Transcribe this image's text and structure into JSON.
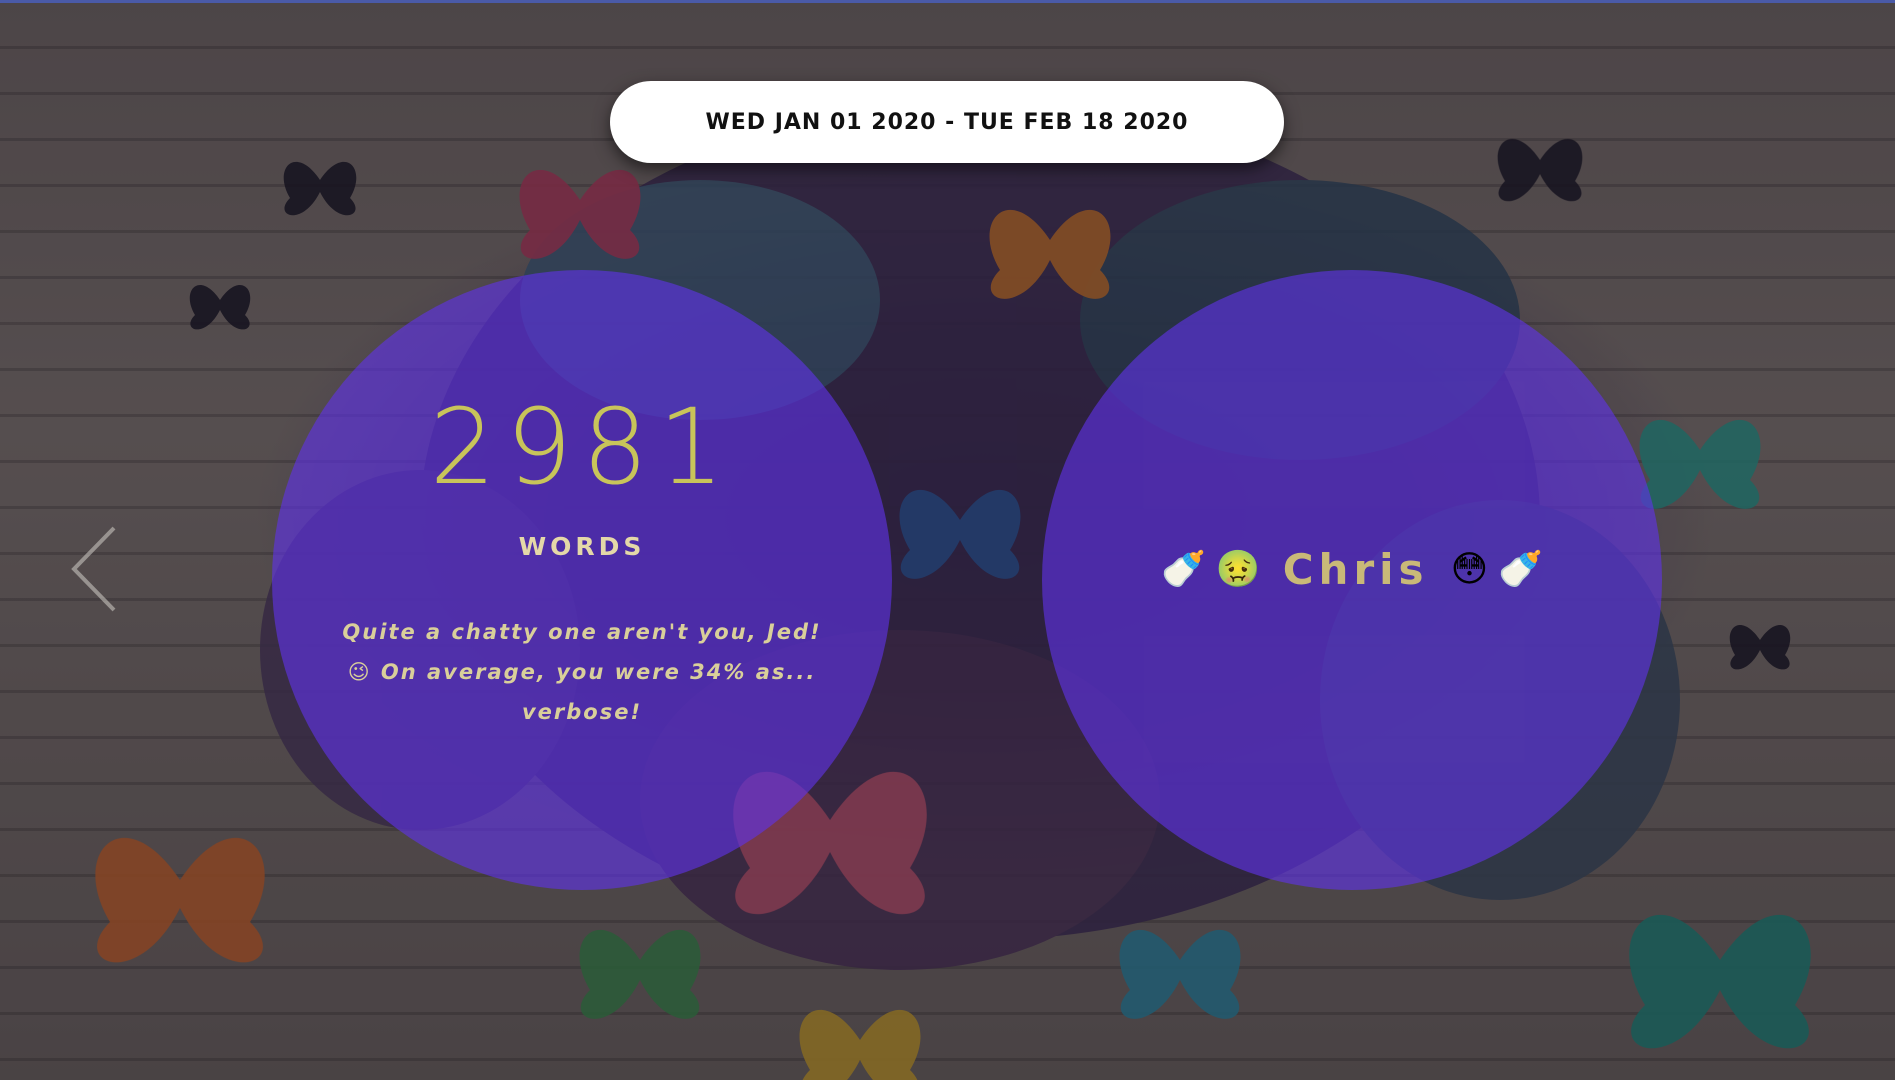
{
  "date_range": "WED JAN 01 2020 - TUE FEB 18 2020",
  "stats": {
    "word_count": "2981",
    "word_label": "WORDS",
    "blurb": "Quite a chatty one aren't you, Jed! 😉 On average, you were 34% as... verbose!"
  },
  "person": {
    "name": "Chris",
    "emojis_before": [
      "🍼",
      "🤢"
    ],
    "emojis_after": [
      "😳",
      "🍼"
    ]
  },
  "nav": {
    "prev_icon": "chevron-left-icon"
  },
  "colors": {
    "circle_fill": "#6034e8",
    "count_color": "#c8c45a",
    "label_color": "#e4d8a8",
    "name_color": "#c9b978",
    "pill_bg": "#ffffff"
  }
}
